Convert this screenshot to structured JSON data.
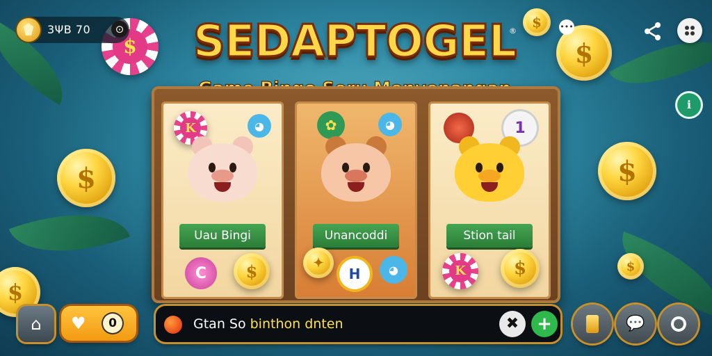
{
  "header": {
    "badge_text": "3ΨВ 70",
    "sound_icon": "speaker-icon",
    "title": "SEDAPTOGEL",
    "registered": "®",
    "subtitle": "Game Bingo Seru Menyenangan"
  },
  "panels": [
    {
      "label": "Uau Bingi",
      "left_chip": "K",
      "bottom_left": "C",
      "bottom_right": "$",
      "character": "pig"
    },
    {
      "label": "Unancoddi",
      "top_badge": "✿",
      "bottom_left": "✦",
      "bottom_mid": "H",
      "character": "pig-brown"
    },
    {
      "label": "Stion tail",
      "top_right": "1",
      "bottom_left": "K",
      "bottom_right": "$",
      "character": "bear"
    }
  ],
  "bottom_bar": {
    "home_icon": "home-icon",
    "coin_value": "0",
    "chat_message_prefix": "Gtan So ",
    "chat_message_highlight": "binthon dnten",
    "close_symbol": "✖",
    "add_symbol": "+",
    "right_buttons": [
      "card-icon",
      "chat-bubble-icon",
      "settings-ring-icon"
    ]
  },
  "side": {
    "side_button_text": "ℹ"
  },
  "colors": {
    "title_fill": "#ffd84a",
    "title_stroke": "#7a2c00",
    "banner_green": "#44a552",
    "board_wood": "#8c5a2b",
    "accent_gold": "#c7902b"
  }
}
